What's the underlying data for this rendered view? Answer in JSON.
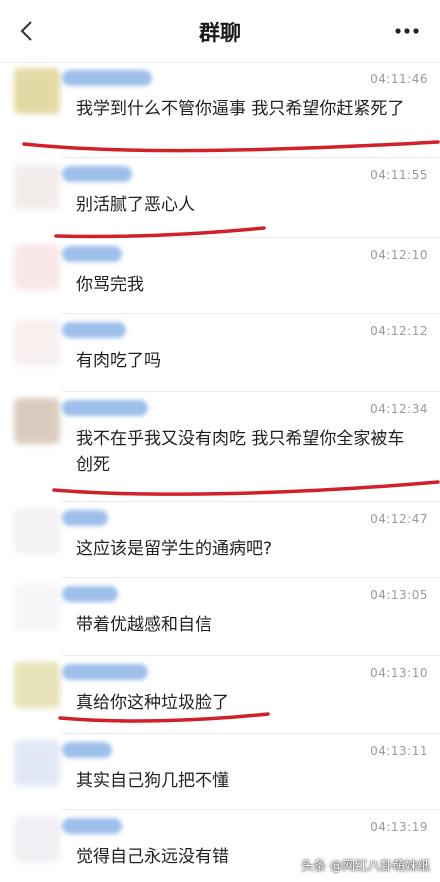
{
  "header": {
    "title": "群聊",
    "back_icon": "chevron-left-icon",
    "more_icon": "more-dots-icon"
  },
  "colors": {
    "annotation_red": "#d0212a",
    "sender_blur": "#8db4e8",
    "timestamp": "#9a9a9a"
  },
  "messages": [
    {
      "time": "04:11:46",
      "text": "我学到什么不管你逼事 我只希望你赶紧死了"
    },
    {
      "time": "04:11:55",
      "text": "别活腻了恶心人"
    },
    {
      "time": "04:12:10",
      "text": "你骂完我"
    },
    {
      "time": "04:12:12",
      "text": "有肉吃了吗"
    },
    {
      "time": "04:12:34",
      "text": "我不在乎我又没有肉吃 我只希望你全家被车创死"
    },
    {
      "time": "04:12:47",
      "text": "这应该是留学生的通病吧?"
    },
    {
      "time": "04:13:05",
      "text": "带着优越感和自信"
    },
    {
      "time": "04:13:10",
      "text": "真给你这种垃圾脸了"
    },
    {
      "time": "04:13:11",
      "text": "其实自己狗几把不懂"
    },
    {
      "time": "04:13:19",
      "text": "觉得自己永远没有错"
    }
  ],
  "watermark": "头条 @网红八卦萌妹纸"
}
